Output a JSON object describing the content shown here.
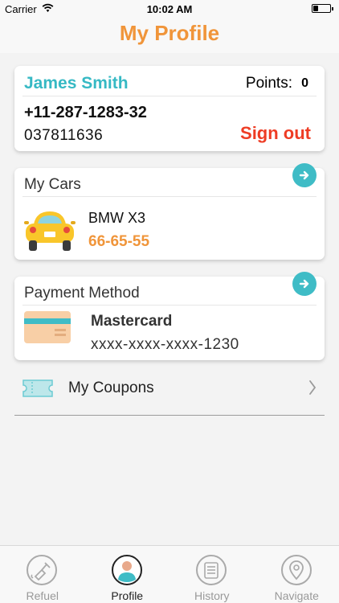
{
  "status_bar": {
    "carrier": "Carrier",
    "time": "10:02 AM",
    "battery_level": 0.3
  },
  "header": {
    "title": "My Profile"
  },
  "profile": {
    "name": "James Smith",
    "points_label": "Points:",
    "points_value": "0",
    "phone": "+11-287-1283-32",
    "id": "037811636",
    "signout_label": "Sign out"
  },
  "cars": {
    "title": "My Cars",
    "items": [
      {
        "model": "BMW X3",
        "plate": "66-65-55",
        "icon": "car-icon"
      }
    ]
  },
  "payment": {
    "title": "Payment Method",
    "items": [
      {
        "name": "Mastercard",
        "number": "xxxx-xxxx-xxxx-1230",
        "icon": "credit-card-icon"
      }
    ]
  },
  "coupons": {
    "label": "My Coupons",
    "icon": "ticket-icon"
  },
  "tabs": [
    {
      "label": "Refuel",
      "icon": "fuel-nozzle-icon",
      "active": false
    },
    {
      "label": "Profile",
      "icon": "user-icon",
      "active": true
    },
    {
      "label": "History",
      "icon": "history-list-icon",
      "active": false
    },
    {
      "label": "Navigate",
      "icon": "map-pin-icon",
      "active": false
    }
  ],
  "colors": {
    "accent_orange": "#f0953a",
    "teal": "#36b9c4",
    "signout_red": "#ee3c24",
    "arrow_teal": "#3fbcc6"
  }
}
